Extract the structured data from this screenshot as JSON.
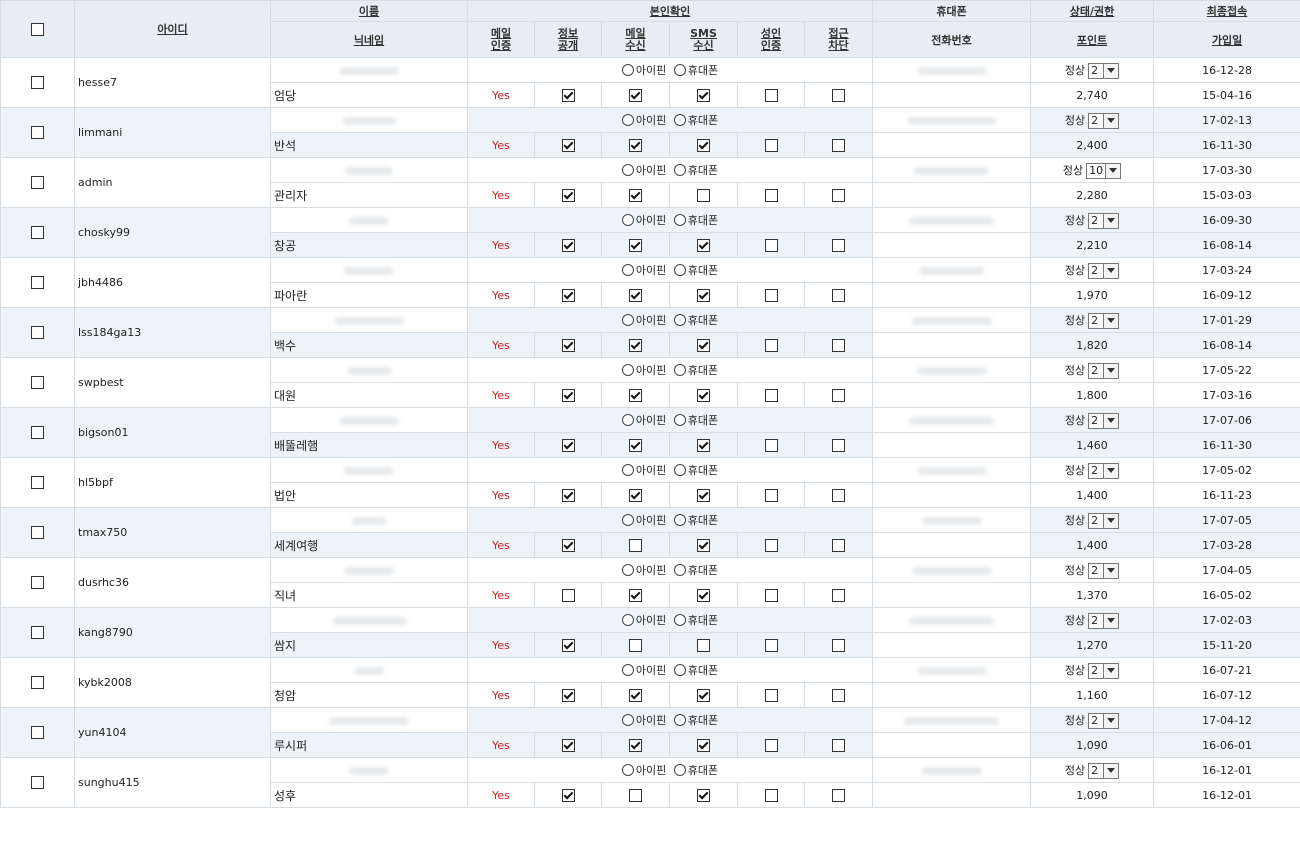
{
  "headers": {
    "id": "아이디",
    "name": "이름",
    "nickname": "닉네임",
    "verify_group": "본인확인",
    "mail_verify": [
      "메일",
      "인증"
    ],
    "info_public": [
      "정보",
      "공개"
    ],
    "mail_receive": [
      "메일",
      "수신"
    ],
    "sms_receive": [
      "SMS",
      "수신"
    ],
    "adult_verify": [
      "성인",
      "인증"
    ],
    "access_block": [
      "접근",
      "차단"
    ],
    "mobile": "휴대폰",
    "phone": "전화번호",
    "status_level": "상태/권한",
    "points": "포인트",
    "last_login": "최종접속",
    "join_date": "가입일"
  },
  "labels": {
    "ipin": "아이핀",
    "mobile_opt": "휴대폰",
    "status": "정상",
    "yes": "Yes"
  },
  "members": [
    {
      "id": "hesse7",
      "nick": "엄당",
      "level": "2",
      "points": "2,740",
      "last": "16-12-28",
      "join": "15-04-16",
      "mail": true,
      "info": true,
      "mailr": true,
      "sms": true,
      "adult": false,
      "block": false
    },
    {
      "id": "limmani",
      "nick": "반석",
      "level": "2",
      "points": "2,400",
      "last": "17-02-13",
      "join": "16-11-30",
      "mail": true,
      "info": true,
      "mailr": true,
      "sms": true,
      "adult": false,
      "block": false
    },
    {
      "id": "admin",
      "nick": "관리자",
      "level": "10",
      "points": "2,280",
      "last": "17-03-30",
      "join": "15-03-03",
      "mail": true,
      "info": true,
      "mailr": true,
      "sms": false,
      "adult": false,
      "block": false
    },
    {
      "id": "chosky99",
      "nick": "창공",
      "level": "2",
      "points": "2,210",
      "last": "16-09-30",
      "join": "16-08-14",
      "mail": true,
      "info": true,
      "mailr": true,
      "sms": true,
      "adult": false,
      "block": false
    },
    {
      "id": "jbh4486",
      "nick": "파아란",
      "level": "2",
      "points": "1,970",
      "last": "17-03-24",
      "join": "16-09-12",
      "mail": true,
      "info": true,
      "mailr": true,
      "sms": true,
      "adult": false,
      "block": false
    },
    {
      "id": "lss184ga13",
      "nick": "백수",
      "level": "2",
      "points": "1,820",
      "last": "17-01-29",
      "join": "16-08-14",
      "mail": true,
      "info": true,
      "mailr": true,
      "sms": true,
      "adult": false,
      "block": false
    },
    {
      "id": "swpbest",
      "nick": "대원",
      "level": "2",
      "points": "1,800",
      "last": "17-05-22",
      "join": "17-03-16",
      "mail": true,
      "info": true,
      "mailr": true,
      "sms": true,
      "adult": false,
      "block": false
    },
    {
      "id": "bigson01",
      "nick": "배뚤레햄",
      "level": "2",
      "points": "1,460",
      "last": "17-07-06",
      "join": "16-11-30",
      "mail": true,
      "info": true,
      "mailr": true,
      "sms": true,
      "adult": false,
      "block": false
    },
    {
      "id": "hl5bpf",
      "nick": "법안",
      "level": "2",
      "points": "1,400",
      "last": "17-05-02",
      "join": "16-11-23",
      "mail": true,
      "info": true,
      "mailr": true,
      "sms": true,
      "adult": false,
      "block": false
    },
    {
      "id": "tmax750",
      "nick": "세계여행",
      "level": "2",
      "points": "1,400",
      "last": "17-07-05",
      "join": "17-03-28",
      "mail": true,
      "info": true,
      "mailr": false,
      "sms": true,
      "adult": false,
      "block": false
    },
    {
      "id": "dusrhc36",
      "nick": "직녀",
      "level": "2",
      "points": "1,370",
      "last": "17-04-05",
      "join": "16-05-02",
      "mail": true,
      "info": false,
      "mailr": true,
      "sms": true,
      "adult": false,
      "block": false
    },
    {
      "id": "kang8790",
      "nick": "쌈지",
      "level": "2",
      "points": "1,270",
      "last": "17-02-03",
      "join": "15-11-20",
      "mail": true,
      "info": true,
      "mailr": false,
      "sms": false,
      "adult": false,
      "block": false
    },
    {
      "id": "kybk2008",
      "nick": "청암",
      "level": "2",
      "points": "1,160",
      "last": "16-07-21",
      "join": "16-07-12",
      "mail": true,
      "info": true,
      "mailr": true,
      "sms": true,
      "adult": false,
      "block": false
    },
    {
      "id": "yun4104",
      "nick": "루시퍼",
      "level": "2",
      "points": "1,090",
      "last": "17-04-12",
      "join": "16-06-01",
      "mail": true,
      "info": true,
      "mailr": true,
      "sms": true,
      "adult": false,
      "block": false
    },
    {
      "id": "sunghu415",
      "nick": "성후",
      "level": "2",
      "points": "1,090",
      "last": "16-12-01",
      "join": "16-12-01",
      "mail": true,
      "info": true,
      "mailr": false,
      "sms": true,
      "adult": false,
      "block": false
    }
  ]
}
